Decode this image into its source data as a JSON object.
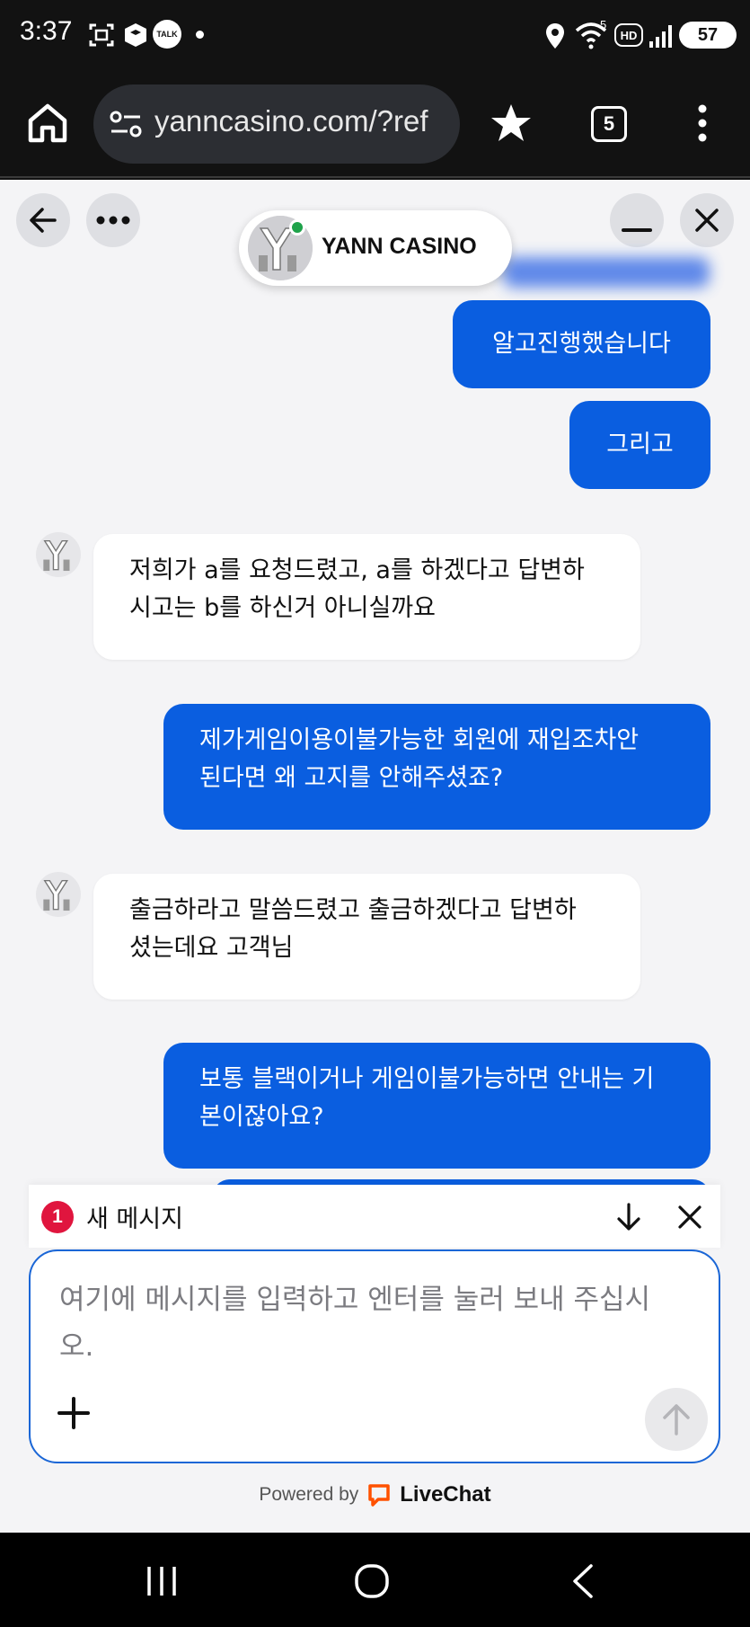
{
  "status_bar": {
    "time": "3:37",
    "notification_icons": [
      "screenshot-icon",
      "cube-app-icon",
      "kakaotalk-icon",
      "dot-icon"
    ],
    "kakaotalk_badge": "TALK",
    "system_icons": [
      "location-icon",
      "wifi-icon",
      "hd-icon",
      "signal-icon"
    ],
    "wifi_label": "5",
    "hd_label": "HD",
    "battery": "57"
  },
  "browser": {
    "url": "yanncasino.com/?ref",
    "tab_count": "5"
  },
  "chat": {
    "brand_name": "YANN CASINO",
    "messages": [
      {
        "sender": "user",
        "text": "알고진행했습니다"
      },
      {
        "sender": "user",
        "text": "그리고"
      },
      {
        "sender": "agent",
        "lines": [
          "저희가 a를 요청드렸고, a를 하겠다고 답변하",
          "시고는 b를 하신거 아니실까요"
        ]
      },
      {
        "sender": "user",
        "lines": [
          "제가게임이용이불가능한 회원에 재입조차안",
          "된다면 왜 고지를 안해주셨죠?"
        ]
      },
      {
        "sender": "agent",
        "lines": [
          "출금하라고 말씀드렸고 출금하겠다고 답변하",
          "셨는데요 고객님"
        ]
      },
      {
        "sender": "user",
        "lines": [
          "보통 블랙이거나 게임이불가능하면 안내는 기",
          "본이잖아요?"
        ]
      }
    ],
    "new_message": {
      "count": "1",
      "label": "새 메시지"
    },
    "composer": {
      "placeholder": "여기에 메시지를 입력하고 엔터를 눌러 보내 주십시오."
    },
    "powered_by": "Powered by",
    "livechat": "LiveChat"
  },
  "colors": {
    "user_bubble": "#0a5ee0",
    "agent_bubble": "#ffffff",
    "badge": "#e0153e",
    "online": "#1ea24a",
    "livechat": "#ff5100"
  }
}
